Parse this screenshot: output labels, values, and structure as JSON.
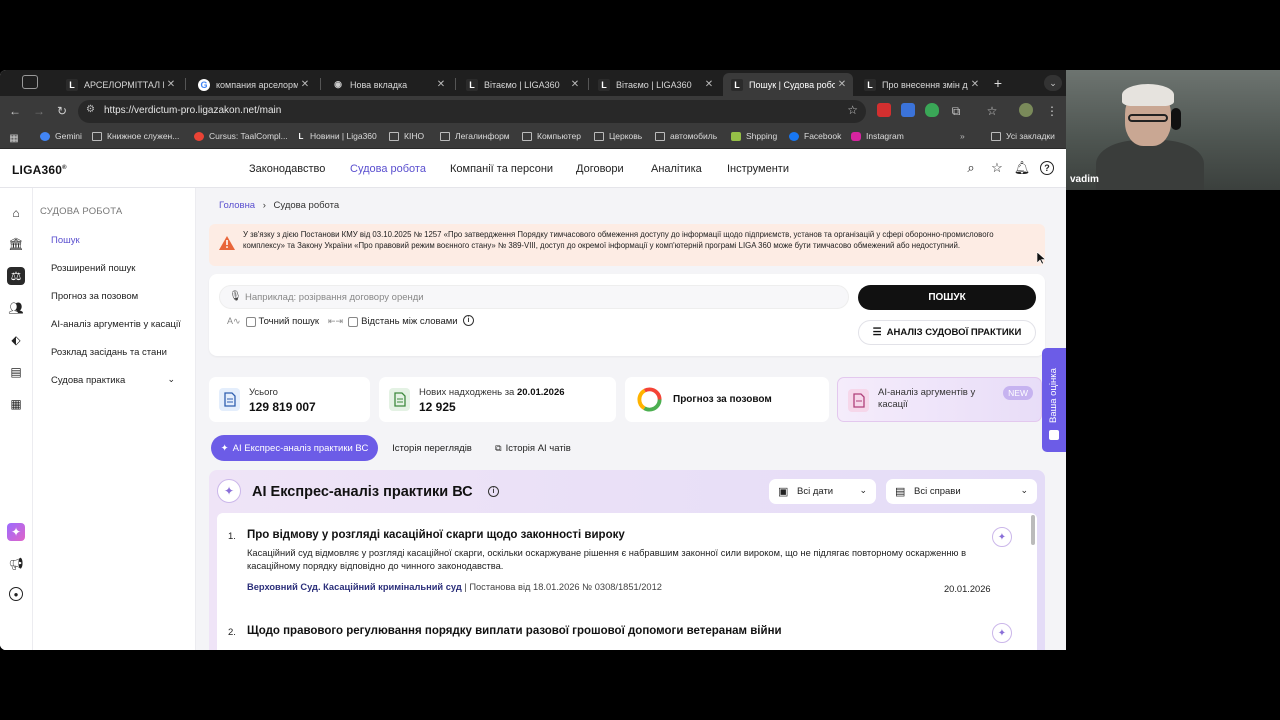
{
  "browser": {
    "tabs": [
      {
        "title": "АРСЕЛОРМІТТАЛ КРИ",
        "favicon": "L",
        "color": "#333"
      },
      {
        "title": "компания арселормиттал",
        "favicon": "G",
        "color": "#4285f4"
      },
      {
        "title": "Нова вкладка",
        "favicon": "◉",
        "color": "#666"
      },
      {
        "title": "Вітаємо | LIGA360",
        "favicon": "L",
        "color": "#333"
      },
      {
        "title": "Вітаємо | LIGA360",
        "favicon": "L",
        "color": "#333"
      },
      {
        "title": "Пошук | Судова робота",
        "favicon": "L",
        "color": "#333",
        "active": true
      },
      {
        "title": "Про внесення змін до",
        "favicon": "L",
        "color": "#333"
      }
    ],
    "url": "https://verdictum-pro.ligazakon.net/main",
    "bookmarks": [
      "Gemini",
      "Книжное служен...",
      "Cursus: TaalCompl...",
      "Новини | Liga360",
      "КІНО",
      "Легалинформ",
      "Компьютер",
      "Церковь",
      "автомобиль",
      "Shpping",
      "Facebook",
      "Instagram"
    ],
    "all_bookmarks": "Усі закладки"
  },
  "app": {
    "logo": "LIGA360",
    "logo_mark": "®",
    "nav": [
      "Законодавство",
      "Судова робота",
      "Компанії та персони",
      "Договори",
      "Аналітика",
      "Інструменти"
    ],
    "nav_active": "Судова робота"
  },
  "sidebar": {
    "heading": "СУДОВА РОБОТА",
    "items": [
      "Пошук",
      "Розширений пошук",
      "Прогноз за позовом",
      "AI-аналіз аргументів у касації",
      "Розклад засідань та стани",
      "Судова практика"
    ]
  },
  "breadcrumb": {
    "home": "Головна",
    "sep": "›",
    "current": "Судова робота"
  },
  "alert": {
    "text": "У зв'язку з дією Постанови КМУ від 03.10.2025 № 1257 «Про затвердження Порядку тимчасового обмеження доступу до інформації щодо підприємств, установ та організацій у сфері оборонно-промислового комплексу» та Закону України «Про правовий режим воєнного стану» № 389-VIII, доступ до окремої інформації у комп'ютерній програмі LIGA 360 може бути тимчасово обмежений або недоступний."
  },
  "search": {
    "placeholder": "Наприклад: розірвання договору оренди",
    "value": "",
    "button": "ПОШУК",
    "exact": "Точний пошук",
    "distance": "Відстань між словами",
    "analysis_button": "АНАЛІЗ СУДОВОЇ ПРАКТИКИ"
  },
  "stats": {
    "total_label": "Усього",
    "total_value": "129 819 007",
    "new_label": "Нових надходжень за",
    "new_date": "20.01.2026",
    "new_value": "12 925",
    "forecast": "Прогноз за позовом",
    "ai_args": "AI-аналіз аргументів у касації",
    "new_badge": "NEW"
  },
  "pills": [
    "AI Експрес-аналіз практики ВС",
    "Історія переглядів",
    "Історія AI чатів"
  ],
  "express": {
    "title": "AI Експрес-аналіз практики ВС",
    "date_filter": "Всі дати",
    "case_filter": "Всі справи",
    "results": [
      {
        "num": "1.",
        "title": "Про відмову у розгляді касаційної скарги щодо законності вироку",
        "body": "Касаційний суд відмовляє у розгляді касаційної скарги, оскільки оскаржуване рішення є набравшим законної сили вироком, що не підлягає повторному оскарженню в касаційному порядку відповідно до чинного законодавства.",
        "court": "Верховний Суд. Касаційний кримінальний суд",
        "decision": "| Постанова від 18.01.2026 № 0308/1851/2012",
        "date": "20.01.2026"
      },
      {
        "num": "2.",
        "title": "Щодо правового регулювання порядку виплати разової грошової допомоги ветеранам війни",
        "body": "",
        "court": "",
        "decision": "",
        "date": ""
      }
    ]
  },
  "feedback": "Ваша оцінка",
  "webcam": {
    "name": "vadim"
  },
  "colors": {
    "accent": "#5a4fcf",
    "primary_button": "#111111",
    "alert_bg": "#fdece4",
    "warning": "#e8653a"
  }
}
